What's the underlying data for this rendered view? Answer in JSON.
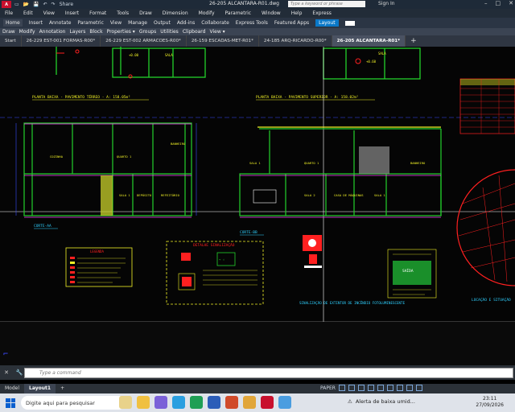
{
  "titlebar": {
    "logo": "A",
    "file_title": "26-205 ALCANTARA-R01.dwg",
    "share": "Share",
    "search_placeholder": "Type a keyword or phrase",
    "sign_in": "Sign In",
    "minimize": "–",
    "maximize": "□",
    "close": "✕"
  },
  "menubar": [
    "File",
    "Edit",
    "View",
    "Insert",
    "Format",
    "Tools",
    "Draw",
    "Dimension",
    "Modify",
    "Parametric",
    "Window",
    "Help",
    "Express"
  ],
  "ribbontabs": [
    "Home",
    "Insert",
    "Annotate",
    "Parametric",
    "View",
    "Manage",
    "Output",
    "Add-ins",
    "Collaborate",
    "Express Tools",
    "Featured Apps",
    "Layout"
  ],
  "panels": [
    "Draw",
    "Modify",
    "Annotation",
    "Layers",
    "Block",
    "Properties ▾",
    "Groups",
    "Utilities",
    "Clipboard",
    "View ▾"
  ],
  "doctabs": [
    {
      "label": "Start"
    },
    {
      "label": "26-229 EST-001 FORMAS-R00*"
    },
    {
      "label": "26-229 EST-002 ARMACOES-R00*"
    },
    {
      "label": "26-159 ESCADAS-MET-R01*"
    },
    {
      "label": "24-185 ARQ-RICARDO-R00*"
    },
    {
      "label": "26-205 ALCANTARA-R01*"
    }
  ],
  "drawing": {
    "plan_terreo": "PLANTA BAIXA - PAVIMENTO TÉRREO - A: 158.05m²",
    "plan_superior": "PLANTA BAIXA - PAVIMENTO SUPERIOR - A: 158.02m²",
    "corte_aa": "CORTE-AA",
    "corte_bb": "CORTE-BB",
    "legenda": "LEGENDA",
    "detalhe": "DETALHE SINALIZAÇÃO",
    "sinalizacao_extintor": "SINALIZAÇÃO DE EXTINTOR DE INCÊNDIO FOTOLUMINESCENTE",
    "locacao": "LOCAÇÃO E SITUAÇÃO",
    "room_labels": [
      "COZINHA",
      "SALA 1",
      "DEPÓSITO",
      "ESCRITÓRIO",
      "QUARTO 1",
      "SALA 2",
      "REFEITÓRIO",
      "BANHEIRO",
      "CASA DE MÁQUINAS"
    ]
  },
  "command": {
    "placeholder": "Type a command",
    "close": "✕",
    "wrench": "🔧"
  },
  "status": {
    "model": "Model",
    "layout1": "Layout1",
    "add": "+",
    "paper": "PAPER"
  },
  "taskbar": {
    "search": "Digite aqui para pesquisar",
    "notification": "Alerta de baixa umid...",
    "time": "23:11",
    "date": "27/09/2026"
  },
  "colors": {
    "green": "#23d12b",
    "yellow": "#f2f226",
    "red": "#ff2020",
    "cyan": "#2fd0ff",
    "magenta": "#ff40ff",
    "blue": "#3a4bff"
  }
}
